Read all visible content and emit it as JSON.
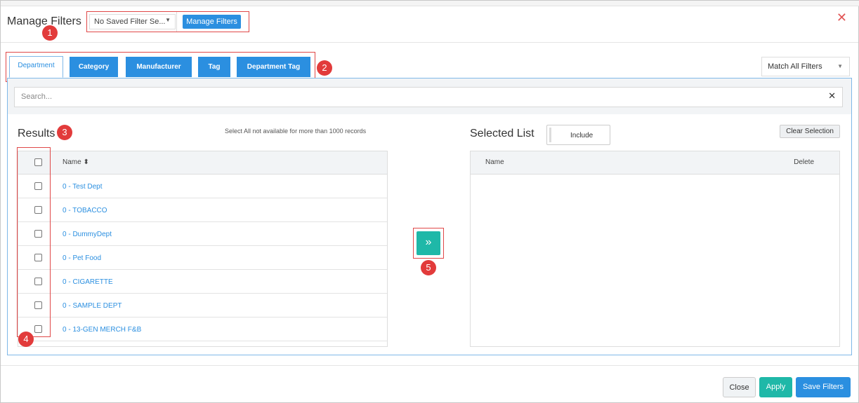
{
  "modal": {
    "title": "Manage Filters",
    "close_glyph": "✕"
  },
  "saved_filter": {
    "selected": "No Saved Filter Se...",
    "manage_label": "Manage Filters"
  },
  "tabs": [
    {
      "label": "Department",
      "active": true
    },
    {
      "label": "Category",
      "active": false
    },
    {
      "label": "Manufacturer",
      "active": false
    },
    {
      "label": "Tag",
      "active": false
    },
    {
      "label": "Department Tag",
      "active": false
    }
  ],
  "match_select": {
    "selected": "Match All Filters"
  },
  "search": {
    "placeholder": "Search...",
    "clear_glyph": "✕"
  },
  "results": {
    "title": "Results",
    "note": "Select All not available for more than 1000 records",
    "column_name": "Name ⬍",
    "rows": [
      "0 - Test Dept",
      "0 - TOBACCO",
      "0 - DummyDept",
      "0 - Pet Food",
      "0 - CIGARETTE",
      "0 - SAMPLE DEPT",
      "0 - 13-GEN MERCH F&B"
    ]
  },
  "transfer": {
    "glyph": "»"
  },
  "selected": {
    "title": "Selected List",
    "include_label": "Include",
    "clear_label": "Clear Selection",
    "column_name": "Name",
    "column_delete": "Delete"
  },
  "footer": {
    "close_label": "Close",
    "apply_label": "Apply",
    "save_label": "Save Filters"
  },
  "callouts": [
    "1",
    "2",
    "3",
    "4",
    "5"
  ],
  "colors": {
    "primary": "#2b8fe0",
    "teal": "#1fb8a8",
    "callout": "#e23b3b",
    "highlight_border": "#e04848"
  }
}
